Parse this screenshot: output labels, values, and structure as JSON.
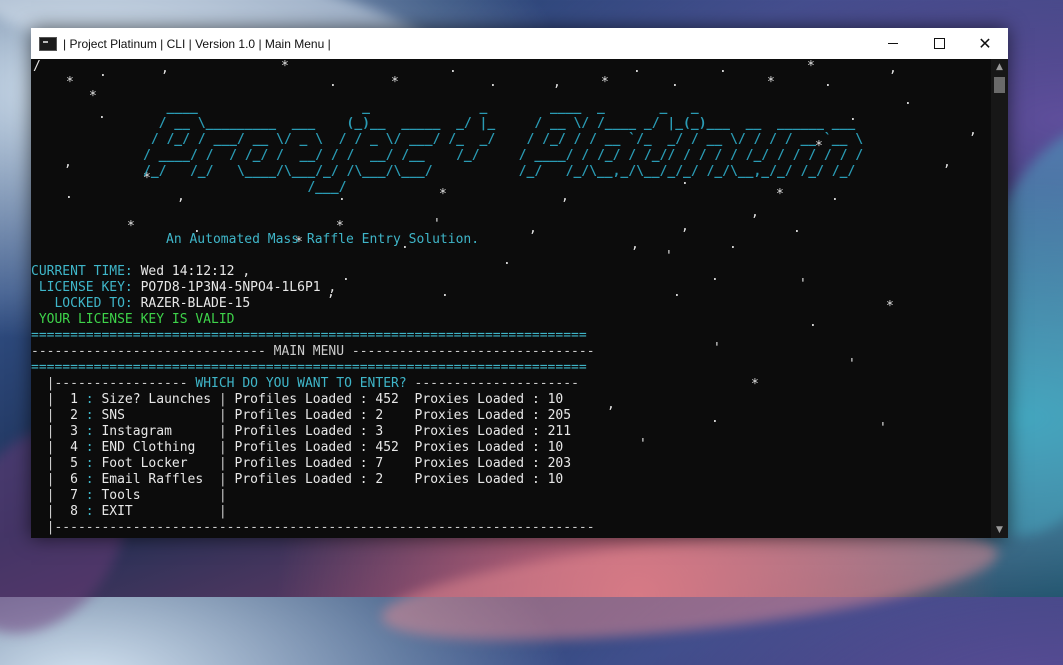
{
  "window": {
    "title": "| Project Platinum | CLI | Version 1.0 | Main Menu |"
  },
  "console": {
    "corner_char": "/",
    "logo_lines": [
      "   ____                     _              _        ____  _       _   _                     ",
      "  / __ \\_________  ___    (_)__  _____  _/ |_     / __ \\/ /____ _/ |_(_)___  __  ______ ___ ",
      " / /_/ / ___/ __ \\/ _ \\  / / _ \\/ ___/ /_  _/    / /_/ / / __ `/_  _/ / __ \\/ / / / __ `__ \\",
      "/ ____/ /  / /_/ /  __/ / /  __/ /__    /_/     / ____/ / /_/ / /_// / / / / /_/ / / / / / /",
      "/_/   /_/   \\____/\\___/_/ /\\___/\\___/           /_/   /_/\\__,_/\\__/_/_/ /_/\\__,_/_/ /_/ /_/ ",
      "                     /___/                                                                    "
    ],
    "tagline": "An Automated Mass Raffle Entry Solution.",
    "info": {
      "current_time_label": "CURRENT TIME:",
      "current_time_value": "Wed 14:12:12 ,",
      "license_key_label": " LICENSE KEY:",
      "license_key_value": "PO7D8-1P3N4-5NPO4-1L6P1 ,",
      "locked_to_label": "   LOCKED TO:",
      "locked_to_value": "RAZER-BLADE-15",
      "valid_message": " YOUR LICENSE KEY IS VALID"
    },
    "menu": {
      "rule_double": "=======================================================================",
      "main_menu_line": "------------------------------ MAIN MENU -------------------------------",
      "which_prefix": "  |----------------- ",
      "which_text": "WHICH DO YOU WANT TO ENTER?",
      "which_suffix": " ---------------------",
      "bottom_rule": "  |---------------------------------------------------------------------",
      "final_rule": "-----------------------------------------------------------------------",
      "items": [
        {
          "num": "1",
          "name": "Size? Launches",
          "profiles_label": "Profiles Loaded :",
          "profiles": "452",
          "proxies_label": "Proxies Loaded :",
          "proxies": "10"
        },
        {
          "num": "2",
          "name": "SNS",
          "profiles_label": "Profiles Loaded :",
          "profiles": "2",
          "proxies_label": "Proxies Loaded :",
          "proxies": "205"
        },
        {
          "num": "3",
          "name": "Instagram",
          "profiles_label": "Profiles Loaded :",
          "profiles": "3",
          "proxies_label": "Proxies Loaded :",
          "proxies": "211"
        },
        {
          "num": "4",
          "name": "END Clothing",
          "profiles_label": "Profiles Loaded :",
          "profiles": "452",
          "proxies_label": "Proxies Loaded :",
          "proxies": "10"
        },
        {
          "num": "5",
          "name": "Foot Locker",
          "profiles_label": "Profiles Loaded :",
          "profiles": "7",
          "proxies_label": "Proxies Loaded :",
          "proxies": "203"
        },
        {
          "num": "6",
          "name": "Email Raffles",
          "profiles_label": "Profiles Loaded :",
          "profiles": "2",
          "proxies_label": "Proxies Loaded :",
          "proxies": "10"
        },
        {
          "num": "7",
          "name": "Tools",
          "profiles_label": "",
          "profiles": "",
          "proxies_label": "",
          "proxies": ""
        },
        {
          "num": "8",
          "name": "EXIT",
          "profiles_label": "",
          "profiles": "",
          "proxies_label": "",
          "proxies": ""
        }
      ]
    }
  },
  "colors": {
    "console_bg": "#0c0c0c",
    "cyan": "#3fb6c9",
    "green": "#3ed34a",
    "text": "#cccccc"
  }
}
